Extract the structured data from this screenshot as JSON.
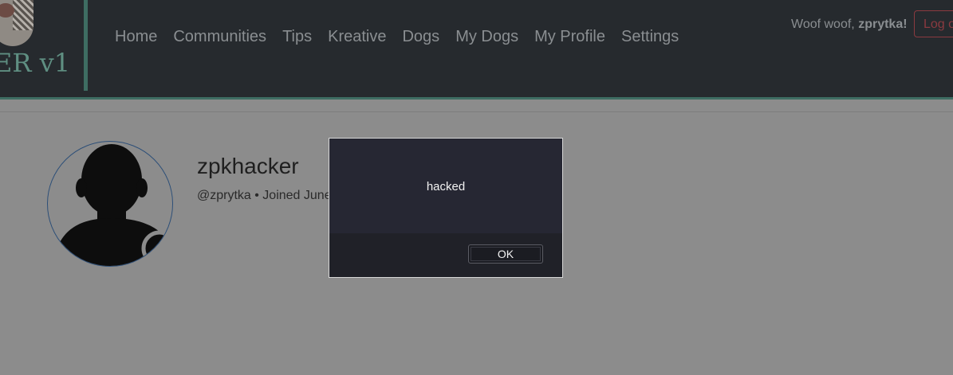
{
  "brand": {
    "text": "ER v1"
  },
  "nav": {
    "items": [
      "Home",
      "Communities",
      "Tips",
      "Kreative",
      "Dogs",
      "My Dogs",
      "My Profile",
      "Settings"
    ]
  },
  "user": {
    "greeting_prefix": "Woof woof, ",
    "username": "zprytka!",
    "logout_label": "Log o"
  },
  "profile": {
    "display_name": "zpkhacker",
    "handle_line": "@zprytka • Joined June"
  },
  "dialog": {
    "message": "hacked",
    "ok_label": "OK"
  },
  "colors": {
    "navbar": "#262a2e",
    "accent": "#3e6d62",
    "overlay": "#8c8c8c",
    "dialog_bg": "#262733",
    "logout": "#8b3a40"
  }
}
